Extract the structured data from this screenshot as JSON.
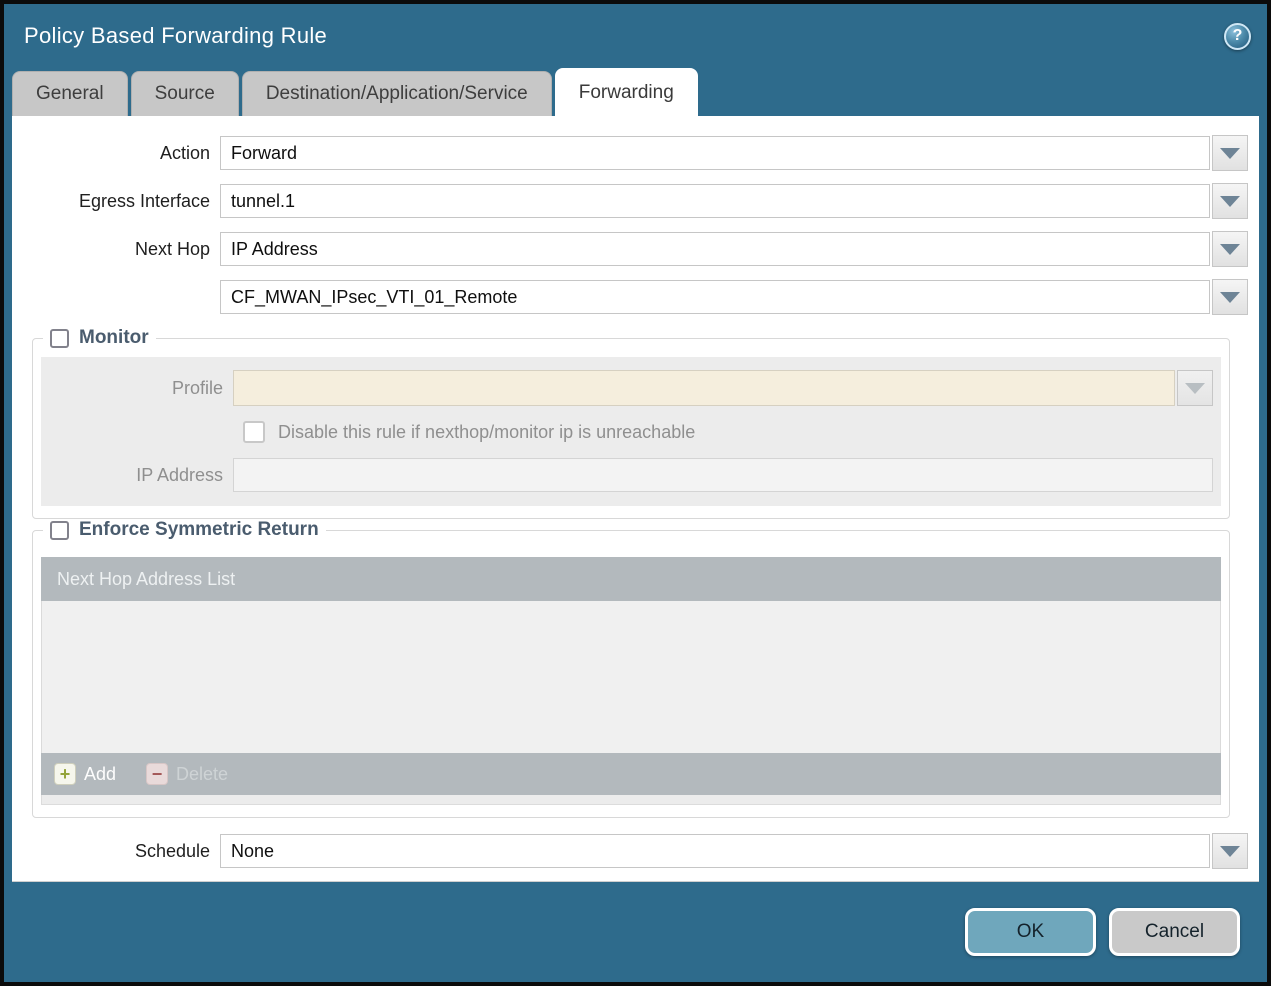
{
  "window": {
    "title": "Policy Based Forwarding Rule"
  },
  "icons": {
    "help_glyph": "?",
    "add_glyph": "+",
    "delete_glyph": "−"
  },
  "tabs": [
    {
      "label": "General",
      "active": false
    },
    {
      "label": "Source",
      "active": false
    },
    {
      "label": "Destination/Application/Service",
      "active": false
    },
    {
      "label": "Forwarding",
      "active": true
    }
  ],
  "form": {
    "action": {
      "label": "Action",
      "value": "Forward"
    },
    "egress_interface": {
      "label": "Egress Interface",
      "value": "tunnel.1"
    },
    "next_hop": {
      "label": "Next Hop",
      "value": "IP Address"
    },
    "next_hop_address": {
      "value": "CF_MWAN_IPsec_VTI_01_Remote"
    },
    "schedule": {
      "label": "Schedule",
      "value": "None"
    }
  },
  "monitor": {
    "legend": "Monitor",
    "checked": false,
    "profile": {
      "label": "Profile",
      "value": ""
    },
    "disable_rule": {
      "label": "Disable this rule if nexthop/monitor ip is unreachable",
      "checked": false
    },
    "ip_address": {
      "label": "IP Address",
      "value": ""
    }
  },
  "symmetric": {
    "legend": "Enforce Symmetric Return",
    "checked": false,
    "table": {
      "header": "Next Hop Address List",
      "rows": [],
      "add_label": "Add",
      "delete_label": "Delete"
    }
  },
  "footer": {
    "ok_label": "OK",
    "cancel_label": "Cancel"
  },
  "colors": {
    "chrome_teal": "#2e6b8c",
    "ok_button": "#6fa7bc",
    "cancel_button": "#c9c9c9",
    "tab_inactive": "#c7c7c7",
    "table_bar": "#b3b9bd",
    "disabled_field_beige": "#f5eedd",
    "disabled_panel": "#ececec",
    "legend_text": "#4a5c6e"
  }
}
